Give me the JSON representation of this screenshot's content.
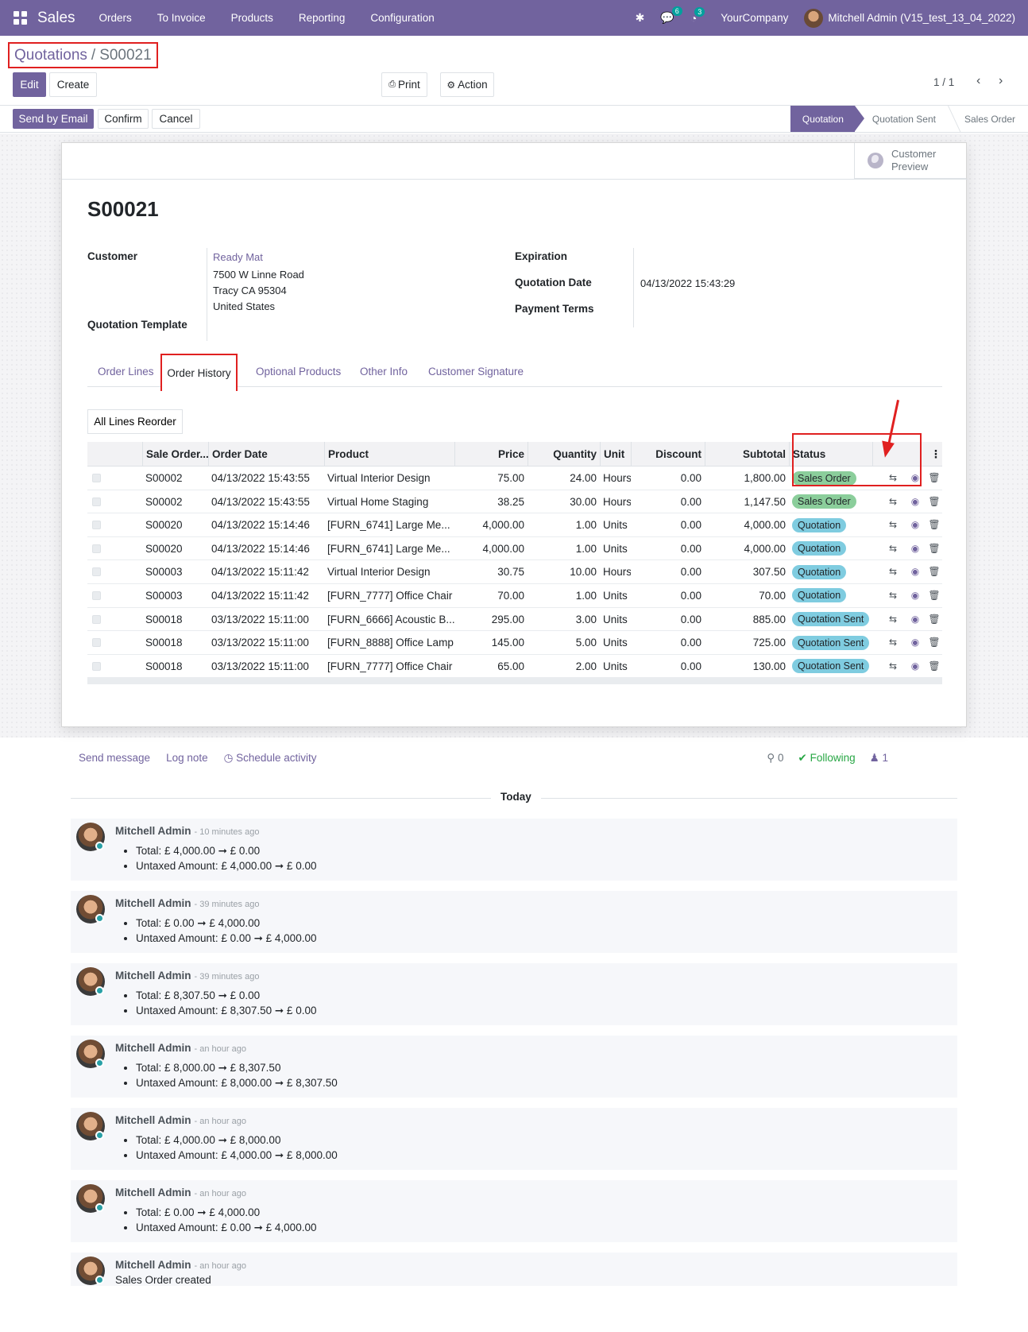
{
  "navbar": {
    "app": "Sales",
    "menu": [
      "Orders",
      "To Invoice",
      "Products",
      "Reporting",
      "Configuration"
    ],
    "chat_count": "6",
    "activity_count": "3",
    "company": "YourCompany",
    "user": "Mitchell Admin (V15_test_13_04_2022)"
  },
  "breadcrumb": {
    "parent": "Quotations",
    "sep": "/",
    "current": "S00021"
  },
  "buttons": {
    "edit": "Edit",
    "create": "Create",
    "print": "Print",
    "action": "Action",
    "send_email": "Send by Email",
    "confirm": "Confirm",
    "cancel": "Cancel"
  },
  "pager": "1 / 1",
  "stages": [
    "Quotation",
    "Quotation Sent",
    "Sales Order"
  ],
  "form": {
    "preview_line1": "Customer",
    "preview_line2": "Preview",
    "title": "S00021",
    "labels": {
      "customer": "Customer",
      "template": "Quotation Template",
      "expiration": "Expiration",
      "qdate": "Quotation Date",
      "terms": "Payment Terms"
    },
    "customer_name": "Ready Mat",
    "addr1": "7500 W Linne Road",
    "addr2": "Tracy CA 95304",
    "addr3": "United States",
    "qdate": "04/13/2022 15:43:29"
  },
  "tabs": [
    "Order Lines",
    "Order History",
    "Optional Products",
    "Other Info",
    "Customer Signature"
  ],
  "reorder": "All Lines Reorder",
  "table": {
    "headers": [
      "Sale Order...",
      "Order Date",
      "Product",
      "Price",
      "Quantity",
      "Unit",
      "Discount",
      "Subtotal",
      "Status"
    ],
    "rows": [
      [
        "S00002",
        "04/13/2022 15:43:55",
        "Virtual Interior Design",
        "75.00",
        "24.00",
        "Hours",
        "0.00",
        "1,800.00",
        "Sales Order"
      ],
      [
        "S00002",
        "04/13/2022 15:43:55",
        "Virtual Home Staging",
        "38.25",
        "30.00",
        "Hours",
        "0.00",
        "1,147.50",
        "Sales Order"
      ],
      [
        "S00020",
        "04/13/2022 15:14:46",
        "[FURN_6741] Large Me...",
        "4,000.00",
        "1.00",
        "Units",
        "0.00",
        "4,000.00",
        "Quotation"
      ],
      [
        "S00020",
        "04/13/2022 15:14:46",
        "[FURN_6741] Large Me...",
        "4,000.00",
        "1.00",
        "Units",
        "0.00",
        "4,000.00",
        "Quotation"
      ],
      [
        "S00003",
        "04/13/2022 15:11:42",
        "Virtual Interior Design",
        "30.75",
        "10.00",
        "Hours",
        "0.00",
        "307.50",
        "Quotation"
      ],
      [
        "S00003",
        "04/13/2022 15:11:42",
        "[FURN_7777] Office Chair",
        "70.00",
        "1.00",
        "Units",
        "0.00",
        "70.00",
        "Quotation"
      ],
      [
        "S00018",
        "03/13/2022 15:11:00",
        "[FURN_6666] Acoustic B...",
        "295.00",
        "3.00",
        "Units",
        "0.00",
        "885.00",
        "Quotation Sent"
      ],
      [
        "S00018",
        "03/13/2022 15:11:00",
        "[FURN_8888] Office Lamp",
        "145.00",
        "5.00",
        "Units",
        "0.00",
        "725.00",
        "Quotation Sent"
      ],
      [
        "S00018",
        "03/13/2022 15:11:00",
        "[FURN_7777] Office Chair",
        "65.00",
        "2.00",
        "Units",
        "0.00",
        "130.00",
        "Quotation Sent"
      ]
    ]
  },
  "chatter": {
    "send": "Send message",
    "log": "Log note",
    "schedule": "Schedule activity",
    "attachments": "0",
    "following": "Following",
    "followers": "1",
    "today": "Today",
    "messages": [
      {
        "author": "Mitchell Admin",
        "ago": "- 10 minutes ago",
        "lines": [
          "Total: £ 4,000.00 ➞ £ 0.00",
          "Untaxed Amount: £ 4,000.00 ➞ £ 0.00"
        ]
      },
      {
        "author": "Mitchell Admin",
        "ago": "- 39 minutes ago",
        "lines": [
          "Total: £ 0.00 ➞ £ 4,000.00",
          "Untaxed Amount: £ 0.00 ➞ £ 4,000.00"
        ]
      },
      {
        "author": "Mitchell Admin",
        "ago": "- 39 minutes ago",
        "lines": [
          "Total: £ 8,307.50 ➞ £ 0.00",
          "Untaxed Amount: £ 8,307.50 ➞ £ 0.00"
        ]
      },
      {
        "author": "Mitchell Admin",
        "ago": "- an hour ago",
        "lines": [
          "Total: £ 8,000.00 ➞ £ 8,307.50",
          "Untaxed Amount: £ 8,000.00 ➞ £ 8,307.50"
        ]
      },
      {
        "author": "Mitchell Admin",
        "ago": "- an hour ago",
        "lines": [
          "Total: £ 4,000.00 ➞ £ 8,000.00",
          "Untaxed Amount: £ 4,000.00 ➞ £ 8,000.00"
        ]
      },
      {
        "author": "Mitchell Admin",
        "ago": "- an hour ago",
        "lines": [
          "Total: £ 0.00 ➞ £ 4,000.00",
          "Untaxed Amount: £ 0.00 ➞ £ 4,000.00"
        ]
      },
      {
        "author": "Mitchell Admin",
        "ago": "- an hour ago",
        "text": "Sales Order created"
      }
    ]
  }
}
